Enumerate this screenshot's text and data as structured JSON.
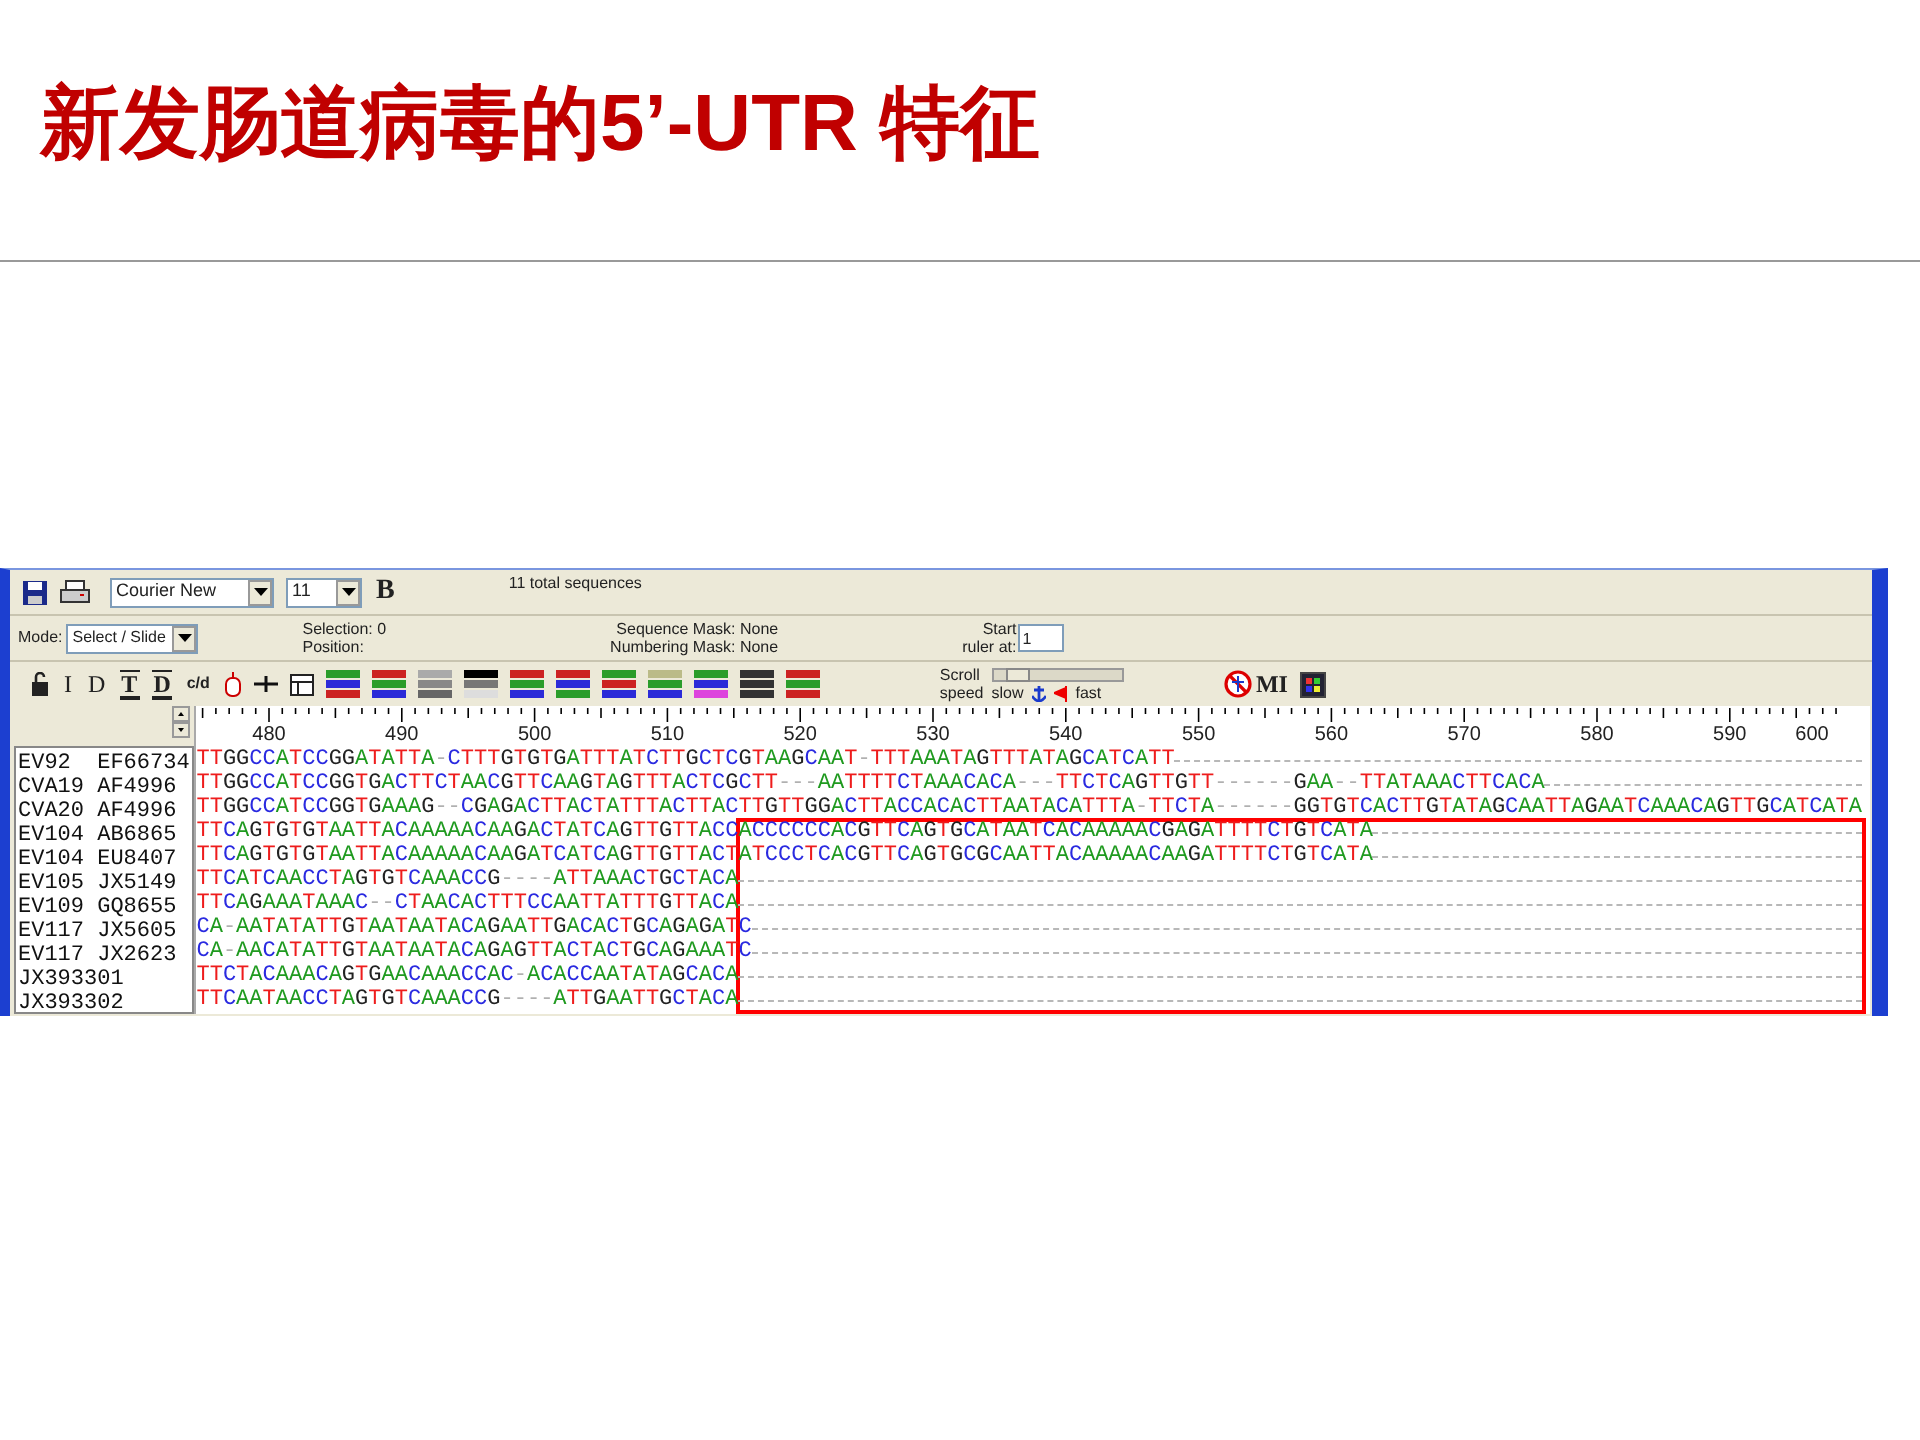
{
  "slide_title": "新发肠道病毒的5’-UTR 特征",
  "toolbar": {
    "font": "Courier New",
    "font_size": "11",
    "bold": "B",
    "sequence_count": "11 total sequences"
  },
  "mode": {
    "label": "Mode:",
    "value": "Select / Slide"
  },
  "selection": "Selection: 0",
  "position": "Position:",
  "sequence_mask": "Sequence Mask: None",
  "numbering_mask": "Numbering Mask: None",
  "ruler_start": {
    "label_1": "Start",
    "label_2": "ruler at:",
    "value": "1"
  },
  "tool_labels": [
    {
      "text": "I",
      "kind": "plain"
    },
    {
      "text": "D",
      "kind": "plain"
    },
    {
      "text": "T",
      "kind": "barred"
    },
    {
      "text": "D",
      "kind": "barred"
    },
    {
      "text": "c/d",
      "kind": "plain"
    }
  ],
  "mi_label": "MI",
  "scroll_speed": {
    "label_1": "Scroll",
    "label_2": "speed",
    "slow": "slow",
    "fast": "fast",
    "level": 0.12
  },
  "ruler": {
    "labels": [
      "480",
      "490",
      "500",
      "510",
      "520",
      "530",
      "540",
      "550",
      "560",
      "570",
      "580",
      "590",
      "600"
    ]
  },
  "sequences": [
    {
      "name": "EV92  EF66734",
      "residues": "TTGGCCATCCGGATATTA-CTTTGTGTGATTTATCTTGCTCGTAAGCAAT-TTTAAATAGTTTATAGCATCATT"
    },
    {
      "name": "CVA19 AF4996",
      "residues": "TTGGCCATCCGGTGACTTCTAACGTTCAAGTAGTTTACTCGCTT---AATTTTCTAAACACA---TTCTCAGTTGTT------GAA--TTATAAACTTCACA"
    },
    {
      "name": "CVA20 AF4996",
      "residues": "TTGGCCATCCGGTGAAAG--CGAGACTTACTATTTACTTACTTGTTGGACTTACCACACTTAATACATTTA-TTCTA------GGTGTCACTTGTATAGCAATTAGAATCAAACAGTTGCATCATA"
    },
    {
      "name": "EV104 AB6865",
      "residues": "TTCAGTGTGTAATTACAAAAACAAGACTATCAGTTGTTACCACCCCCCACGTTCAGTGCATAATCACAAAAACGAGATTTTCTGTCATA"
    },
    {
      "name": "EV104 EU8407",
      "residues": "TTCAGTGTGTAATTACAAAAACAAGATCATCAGTTGTTACTATCCCTCACGTTCAGTGCGCAATTACAAAAACAAGATTTTCTGTCATA"
    },
    {
      "name": "EV105 JX5149",
      "residues": "TTCATCAACCTAGTGTCAAACCG----ATTAAACTGCTACA"
    },
    {
      "name": "EV109 GQ8655",
      "residues": "TTCAGAAATAAAC--CTAACACTTTCCAATTATTTGTTACA"
    },
    {
      "name": "EV117 JX5605",
      "residues": "CA-AATATATTGTAATAATACAGAATTGACACTGCAGAGATC"
    },
    {
      "name": "EV117 JX2623",
      "residues": "CA-AACATATTGTAATAATACAGAGTTACTACTGCAGAAATC"
    },
    {
      "name": "JX393301",
      "residues": "TTCTACAAACAGTGAACAAACCAC-ACACCAATATAGCACA"
    },
    {
      "name": "JX393302",
      "residues": "TTCAATAACCTAGTGTCAAACCG----ATTGAATTGCTACA"
    }
  ]
}
